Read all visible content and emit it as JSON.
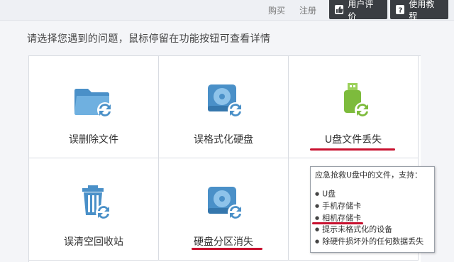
{
  "topbar": {
    "buy_label": "购买",
    "register_label": "注册",
    "review_label": "用户评价",
    "tutorial_label": "使用教程"
  },
  "instruction": "请选择您遇到的问题，鼠标停留在功能按钮可查看详情",
  "options": [
    {
      "label": "误删除文件",
      "icon": "folder-recover-icon"
    },
    {
      "label": "误格式化硬盘",
      "icon": "harddisk-recover-icon"
    },
    {
      "label": "U盘文件丢失",
      "icon": "usb-drive-recover-icon"
    },
    {
      "label": "误清空回收站",
      "icon": "recycle-bin-recover-icon"
    },
    {
      "label": "硬盘分区消失",
      "icon": "partition-recover-icon"
    }
  ],
  "tooltip": {
    "title": "应急抢救U盘中的文件，支持：",
    "items": [
      "U盘",
      "手机存储卡",
      "相机存储卡",
      "提示未格式化的设备",
      "除硬件损坏外的任何数据丢失"
    ]
  },
  "colors": {
    "accent": "#4a90c8",
    "usb_green": "#7dbb3c",
    "underline": "#c8102e",
    "dark_button": "#3a3d42"
  }
}
